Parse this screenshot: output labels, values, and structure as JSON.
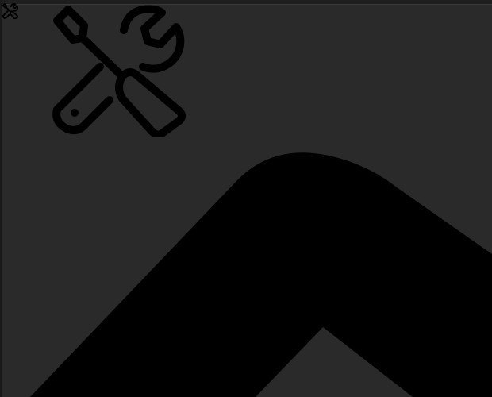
{
  "icons": {
    "small": "tools-icon",
    "large": "tools-icon",
    "shape": "chevron-up-icon"
  },
  "colors": {
    "background": "#2a2a2a",
    "icon": "#000000"
  }
}
